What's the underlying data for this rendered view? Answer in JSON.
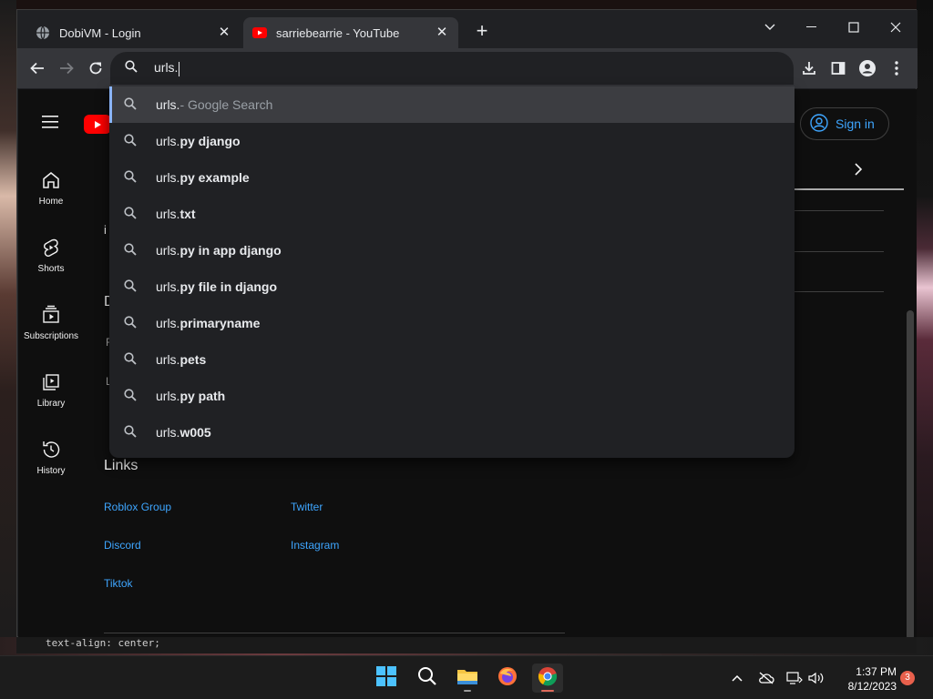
{
  "tabs": [
    {
      "title": "DobiVM - Login",
      "favicon": "globe-icon",
      "close": "✕"
    },
    {
      "title": "sarriebearrie - YouTube",
      "favicon": "youtube-icon",
      "close": "✕"
    }
  ],
  "new_tab": "+",
  "omnibox": {
    "value": "urls."
  },
  "suggestions": [
    {
      "typed": "urls.",
      "rest": "",
      "suffix": " - Google Search"
    },
    {
      "typed": "urls.",
      "rest": "py django",
      "suffix": ""
    },
    {
      "typed": "urls.",
      "rest": "py example",
      "suffix": ""
    },
    {
      "typed": "urls.",
      "rest": "txt",
      "suffix": ""
    },
    {
      "typed": "urls.",
      "rest": "py in app django",
      "suffix": ""
    },
    {
      "typed": "urls.",
      "rest": "py file in django",
      "suffix": ""
    },
    {
      "typed": "urls.",
      "rest": "primaryname",
      "suffix": ""
    },
    {
      "typed": "urls.",
      "rest": "pets",
      "suffix": ""
    },
    {
      "typed": "urls.",
      "rest": "py path",
      "suffix": ""
    },
    {
      "typed": "urls.",
      "rest": "w005",
      "suffix": ""
    }
  ],
  "youtube": {
    "guide": [
      {
        "label": "Home",
        "icon": "home-icon"
      },
      {
        "label": "Shorts",
        "icon": "shorts-icon"
      },
      {
        "label": "Subscriptions",
        "icon": "subscriptions-icon"
      },
      {
        "label": "Library",
        "icon": "library-icon"
      },
      {
        "label": "History",
        "icon": "history-icon"
      }
    ],
    "sign_in": "Sign in",
    "partial": {
      "a": "i",
      "b": "D",
      "c": "F",
      "d": "L"
    },
    "links_title": "Links",
    "links": [
      "Roblox Group",
      "Twitter",
      "Discord",
      "Instagram",
      "Tiktok"
    ]
  },
  "code_snippet": "text-align: center;",
  "taskbar": {
    "time": "1:37 PM",
    "date": "8/12/2023",
    "notifications": "3"
  },
  "colors": {
    "accent": "#8ab4f8",
    "youtube_red": "#ff0000",
    "link": "#3ea6ff"
  }
}
